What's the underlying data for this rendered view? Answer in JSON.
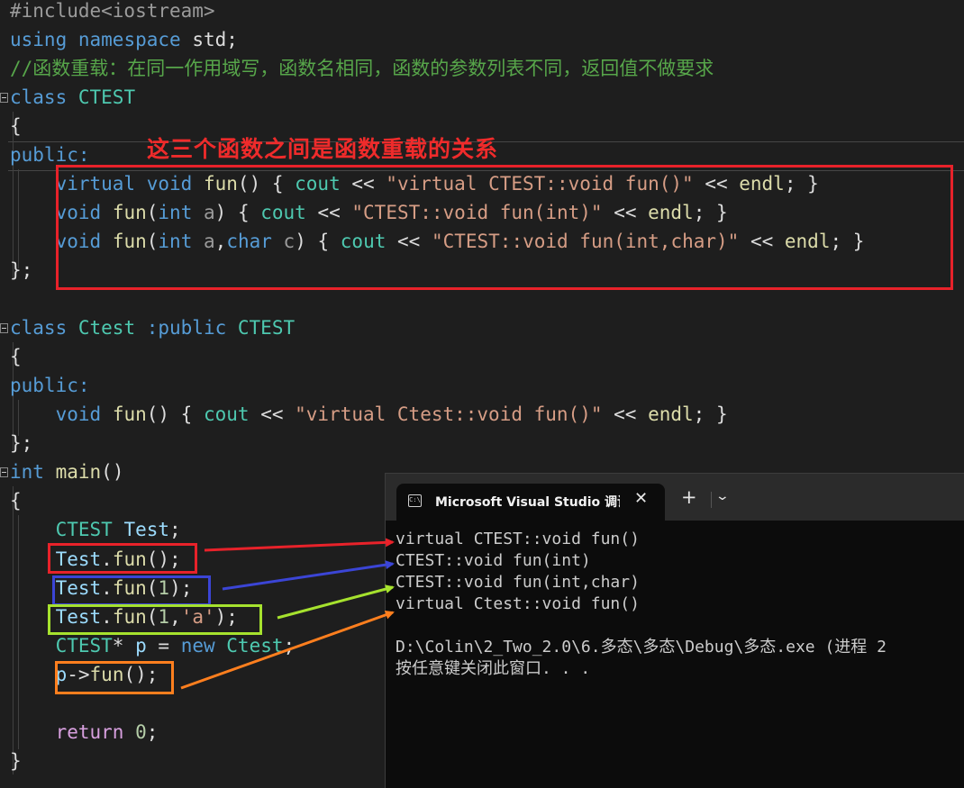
{
  "code": {
    "include": "#include<iostream>",
    "using_kw": "using",
    "namespace_kw": "namespace",
    "using_rest": " std;",
    "comment": "//函数重载：在同一作用域写，函数名相同，函数的参数列表不同，返回值不做要求",
    "class_kw": "class",
    "class1_name": "CTEST",
    "open_brace": "{",
    "public_kw": "public:",
    "close_class": "};",
    "virtual_kw": "virtual",
    "void_kw": "void",
    "fun_name": "fun",
    "int_kw": "int",
    "char_kw": "char",
    "cout_kw": "cout",
    "endl_kw": "endl",
    "str1": "\"virtual CTEST::void fun()\"",
    "str2": "\"CTEST::void fun(int)\"",
    "str3": "\"CTEST::void fun(int,char)\"",
    "class2_name": "Ctest",
    "class2_inherit": " :public ",
    "str4": "\"virtual Ctest::void fun()\"",
    "main_name": "main",
    "test_var": "Test",
    "ptr_var": "p",
    "new_kw": "new",
    "return_kw": "return",
    "char_literal": "'a'"
  },
  "annotation": "这三个函数之间是函数重载的关系",
  "console": {
    "tab_title": "Microsoft Visual Studio 调试控制台",
    "tab_close": "✕",
    "tab_add": "+",
    "tab_dropdown": "⌄",
    "lines": [
      "virtual CTEST::void fun()",
      "CTEST::void fun(int)",
      "CTEST::void fun(int,char)",
      "virtual Ctest::void fun()",
      "",
      "D:\\Colin\\2_Two_2.0\\6.多态\\多态\\Debug\\多态.exe (进程 2",
      "按任意键关闭此窗口. . ."
    ]
  },
  "colors": {
    "red": "#e8222a",
    "blue": "#3b45d6",
    "lime": "#a6e22e",
    "orange": "#ff7f1e"
  }
}
